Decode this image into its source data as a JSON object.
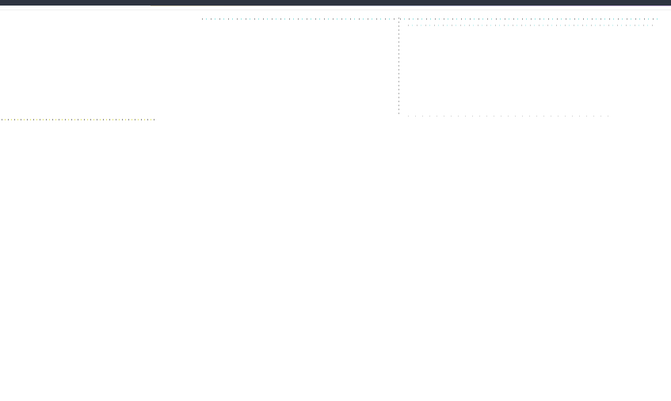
{
  "window": {
    "topbar_color": "#2e3440",
    "background_color": "#ffffff"
  }
}
